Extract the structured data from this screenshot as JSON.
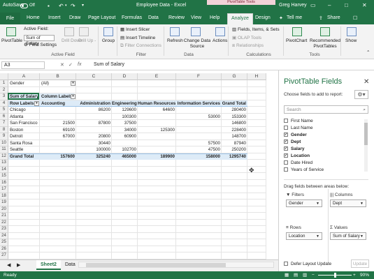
{
  "titlebar": {
    "autosave": "AutoSave",
    "autosave_state": "Off",
    "doc_title": "Employee Data - Excel",
    "context_label": "PivotTable Tools",
    "user": "Greg Harvey"
  },
  "tabs": [
    "File",
    "Home",
    "Insert",
    "Draw",
    "Page Layout",
    "Formulas",
    "Data",
    "Review",
    "View",
    "Help",
    "Analyze",
    "Design"
  ],
  "tell_me": "Tell me",
  "share": "Share",
  "ribbon": {
    "pivottable": "PivotTable",
    "active_field_label": "Active Field:",
    "active_field_value": "Sum of Salary",
    "field_settings": "Field Settings",
    "drill_down": "Drill Down",
    "drill_up": "Drill Up -",
    "group": "Group",
    "insert_slicer": "Insert Slicer",
    "insert_timeline": "Insert Timeline",
    "filter_connections": "Filter Connections",
    "refresh": "Refresh",
    "change_data_source": "Change Data Source",
    "actions": "Actions",
    "fields_items_sets": "Fields, Items, & Sets",
    "olap_tools": "OLAP Tools",
    "relationships": "Relationships",
    "pivotchart": "PivotChart",
    "recommended": "Recommended PivotTables",
    "show": "Show",
    "groups": [
      "Active Field",
      "Filter",
      "Data",
      "Calculations",
      "Tools"
    ]
  },
  "formula_bar": {
    "name_box": "A3",
    "fx": "fx",
    "value": "Sum of Salary"
  },
  "columns": [
    "A",
    "B",
    "C",
    "D",
    "E",
    "F",
    "G",
    "H"
  ],
  "rows": [
    "1",
    "2",
    "3",
    "4",
    "5",
    "6",
    "7",
    "8",
    "9",
    "10",
    "11",
    "12",
    "13",
    "14",
    "15",
    "16",
    "17",
    "18",
    "19",
    "20",
    "21",
    "22",
    "23",
    "24",
    "25",
    "26",
    "27"
  ],
  "pivot": {
    "filter_label": "Gender",
    "filter_value": "(All)",
    "sum_label": "Sum of Salary",
    "col_labels": "Column Labels",
    "row_labels": "Row Labels",
    "headers": [
      "Accounting",
      "Administration",
      "Engineering",
      "Human Resources",
      "Information Services",
      "Grand Total"
    ],
    "rows": [
      {
        "label": "Chicago",
        "values": [
          "",
          "86200",
          "129600",
          "64600",
          "",
          "280400"
        ]
      },
      {
        "label": "Atlanta",
        "values": [
          "",
          "",
          "100300",
          "",
          "53000",
          "153300"
        ]
      },
      {
        "label": "San Francisco",
        "values": [
          "21500",
          "87800",
          "37500",
          "",
          "",
          "146800"
        ]
      },
      {
        "label": "Boston",
        "values": [
          "69100",
          "",
          "34000",
          "125300",
          "",
          "228400"
        ]
      },
      {
        "label": "Detroit",
        "values": [
          "67000",
          "20800",
          "60900",
          "",
          "",
          "148700"
        ]
      },
      {
        "label": "Santa Rosa",
        "values": [
          "",
          "30440",
          "",
          "",
          "57500",
          "87940"
        ]
      },
      {
        "label": "Seattle",
        "values": [
          "",
          "100000",
          "102700",
          "",
          "47500",
          "250200"
        ]
      }
    ],
    "grand_total_label": "Grand Total",
    "grand_total": [
      "157600",
      "325240",
      "465000",
      "189900",
      "158000",
      "1295740"
    ]
  },
  "sheets": [
    "Sheet2",
    "Data"
  ],
  "status": {
    "ready": "Ready",
    "zoom": "90%"
  },
  "panel": {
    "title": "PivotTable Fields",
    "subtitle": "Choose fields to add to report:",
    "search_placeholder": "Search",
    "fields": [
      {
        "name": "First Name",
        "checked": false
      },
      {
        "name": "Last Name",
        "checked": false
      },
      {
        "name": "Gender",
        "checked": true
      },
      {
        "name": "Dept",
        "checked": true
      },
      {
        "name": "Salary",
        "checked": true
      },
      {
        "name": "Location",
        "checked": true
      },
      {
        "name": "Date Hired",
        "checked": false
      },
      {
        "name": "Years of Service",
        "checked": false
      }
    ],
    "drag_label": "Drag fields between areas below:",
    "filters_label": "Filters",
    "columns_label": "Columns",
    "rows_label": "Rows",
    "values_label": "Values",
    "filters_field": "Gender",
    "columns_field": "Dept",
    "rows_field": "Location",
    "values_field": "Sum of Salary",
    "defer": "Defer Layout Update",
    "update": "Update"
  },
  "colors": {
    "excel_green": "#217346",
    "pivot_band": "#ddebf7"
  }
}
